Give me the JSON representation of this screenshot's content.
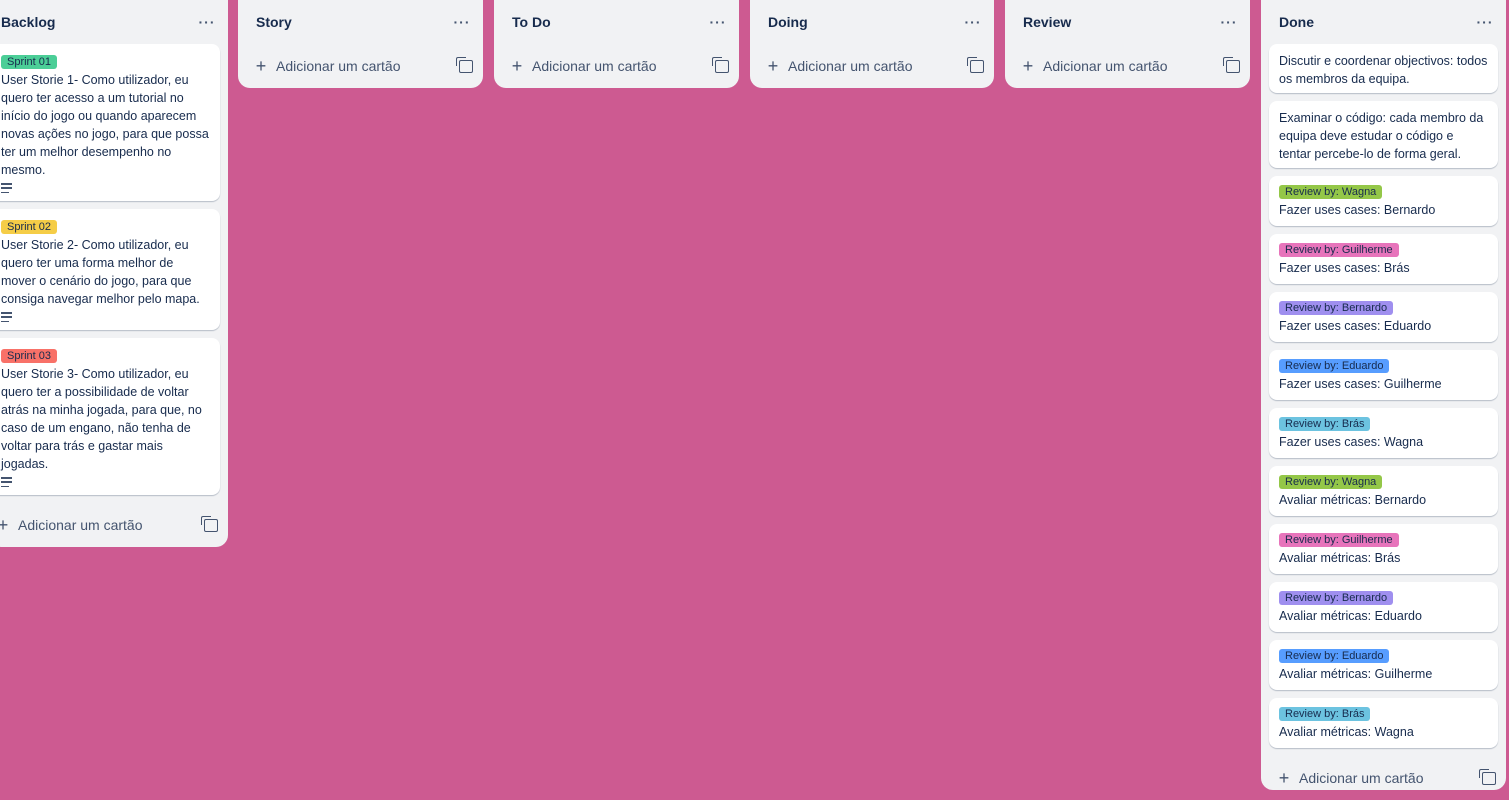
{
  "lists": {
    "backlog": {
      "title": "Backlog",
      "add_label": "Adicionar um cartão",
      "cards": [
        {
          "label": "Sprint 01",
          "label_color": "#4bce97",
          "text": "User Storie 1- Como utilizador, eu quero ter acesso a um tutorial no início do jogo ou quando aparecem novas ações no jogo, para que possa ter um melhor desempenho no mesmo."
        },
        {
          "label": "Sprint 02",
          "label_color": "#f5cd47",
          "text": "User Storie 2- Como utilizador, eu quero ter uma forma melhor de mover o cenário do jogo, para que consiga navegar melhor pelo mapa."
        },
        {
          "label": "Sprint 03",
          "label_color": "#f87168",
          "text": "User Storie 3- Como utilizador, eu quero ter a possibilidade de voltar atrás na minha jogada, para que, no caso de um engano, não tenha de voltar para trás e gastar mais jogadas."
        }
      ]
    },
    "story": {
      "title": "Story",
      "add_label": "Adicionar um cartão"
    },
    "todo": {
      "title": "To Do",
      "add_label": "Adicionar um cartão"
    },
    "doing": {
      "title": "Doing",
      "add_label": "Adicionar um cartão"
    },
    "review": {
      "title": "Review",
      "add_label": "Adicionar um cartão"
    },
    "done": {
      "title": "Done",
      "add_label": "Adicionar um cartão",
      "cards": [
        {
          "text": "Discutir e coordenar objectivos: todos os membros da equipa."
        },
        {
          "text": "Examinar o código: cada membro da equipa deve estudar o código e tentar percebe-lo de forma geral."
        },
        {
          "label": "Review by: Wagna",
          "label_color": "#94c748",
          "text": "Fazer uses cases: Bernardo"
        },
        {
          "label": "Review by: Guilherme",
          "label_color": "#e774bb",
          "text": "Fazer uses cases: Brás"
        },
        {
          "label": "Review by: Bernardo",
          "label_color": "#9f8fef",
          "text": "Fazer uses cases: Eduardo"
        },
        {
          "label": "Review by: Eduardo",
          "label_color": "#579dff",
          "text": "Fazer uses cases: Guilherme"
        },
        {
          "label": "Review by: Brás",
          "label_color": "#6cc3e0",
          "text": "Fazer uses cases: Wagna"
        },
        {
          "label": "Review by: Wagna",
          "label_color": "#94c748",
          "text": "Avaliar métricas: Bernardo"
        },
        {
          "label": "Review by: Guilherme",
          "label_color": "#e774bb",
          "text": "Avaliar métricas: Brás"
        },
        {
          "label": "Review by: Bernardo",
          "label_color": "#9f8fef",
          "text": "Avaliar métricas: Eduardo"
        },
        {
          "label": "Review by: Eduardo",
          "label_color": "#579dff",
          "text": "Avaliar métricas: Guilherme"
        },
        {
          "label": "Review by: Brás",
          "label_color": "#6cc3e0",
          "text": "Avaliar métricas: Wagna"
        }
      ]
    }
  },
  "icons": {
    "menu": "ellipsis-icon",
    "add": "plus-icon",
    "template": "card-template-icon",
    "description": "description-icon"
  }
}
